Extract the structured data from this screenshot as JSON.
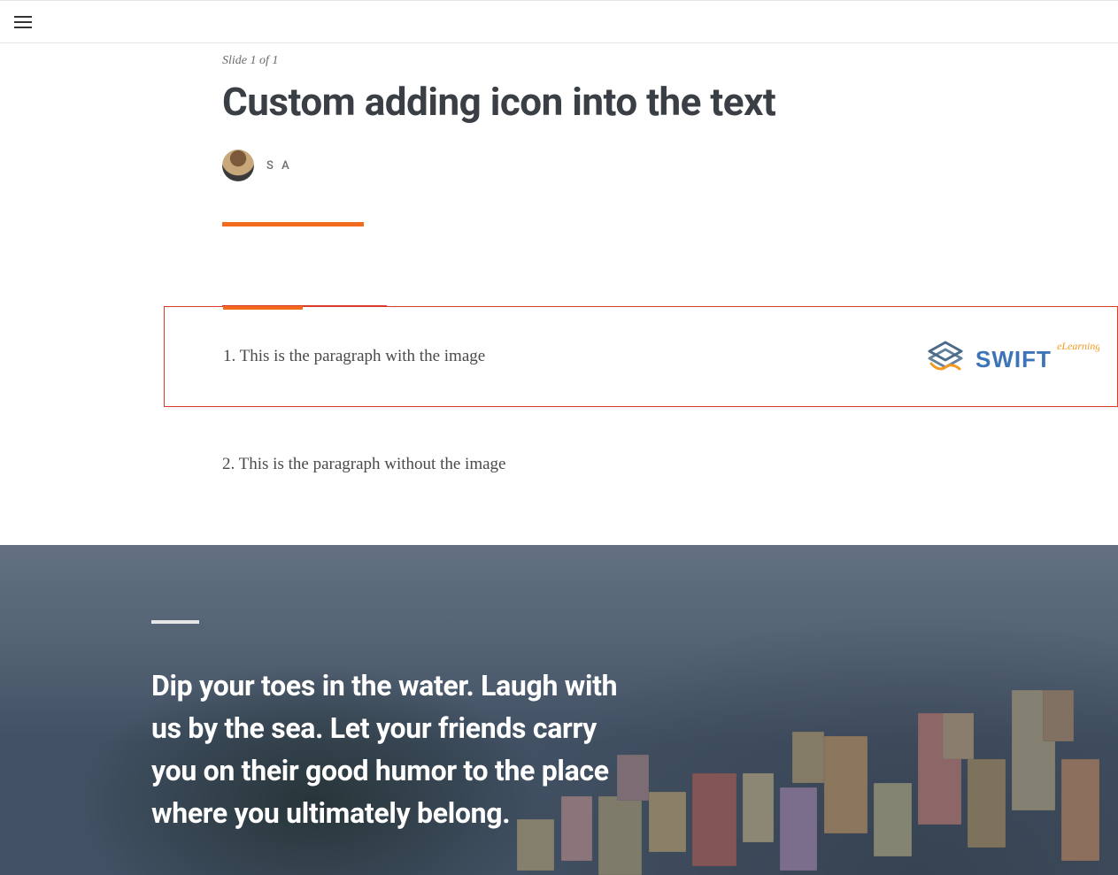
{
  "header": {
    "slide_label": "Slide 1 of 1",
    "title": "Custom adding icon into the text",
    "author_initials": "S A"
  },
  "body": {
    "paragraph1": "1. This is the paragraph with the image",
    "paragraph2": "2. This is the paragraph without the image",
    "logo_brand": "SWIFT",
    "logo_tagline": "eLearning"
  },
  "hero": {
    "text": "Dip your toes in the water. Laugh with us by the sea. Let your friends carry you on their good humor to the place where you ultimately belong."
  }
}
